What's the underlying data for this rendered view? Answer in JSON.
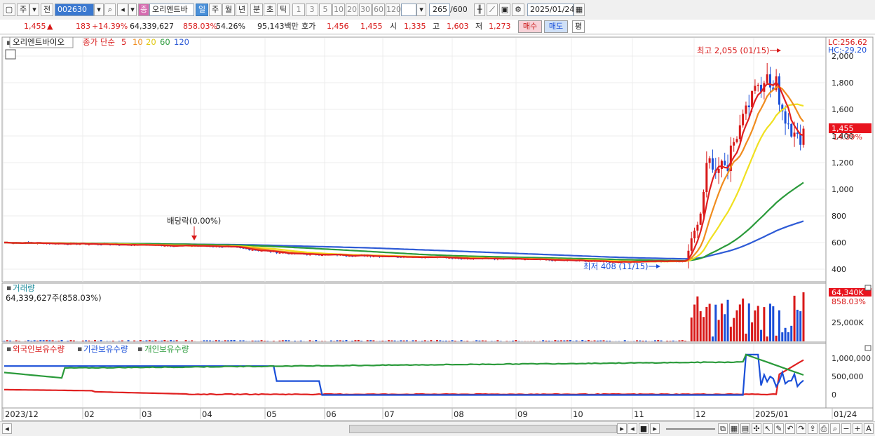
{
  "toolbar": {
    "period_left": "주",
    "jeon_label": "전",
    "code": "002630",
    "stock_name": "오리엔트바",
    "jong_badge": "종",
    "periods": [
      "일",
      "주",
      "월",
      "년",
      "분",
      "초",
      "틱"
    ],
    "intervals": [
      "1",
      "3",
      "5",
      "10",
      "20",
      "30",
      "60",
      "120"
    ],
    "count": "265",
    "count_total": "/600",
    "date": "2025/01/24"
  },
  "info": {
    "price": "1,455",
    "up_arrow": "▲",
    "change": "183",
    "change_pct": "+14.39%",
    "volume": "64,339,627",
    "vol_pct": "858.03%",
    "rate": "54.26%",
    "amount": "95,143백만",
    "hoga_label": "호가",
    "ask": "1,456",
    "bid": "1,455",
    "open_label": "시",
    "open": "1,335",
    "high_label": "고",
    "high": "1,603",
    "low_label": "저",
    "low": "1,273",
    "buy_label": "매수",
    "sell_label": "매도",
    "avg_label": "평"
  },
  "price_panel": {
    "stock_label": "오리엔트바이오",
    "ma_label": "종가 단순",
    "ma_periods": [
      "5",
      "10",
      "20",
      "60",
      "120"
    ],
    "lc": "LC:256.62",
    "hc": "HC:-29.20",
    "high_note": "최고 2,055 (01/15)",
    "low_note": "최저 408 (11/15)",
    "dividend_note": "배당락(0.00%)",
    "current_price": "1,455",
    "current_pct": "14.39%",
    "y_ticks": [
      "2,000",
      "1,800",
      "1,600",
      "1,400",
      "1,200",
      "1,000",
      "800",
      "600",
      "400"
    ]
  },
  "volume_panel": {
    "title": "거래량",
    "value": "64,339,627주(858.03%)",
    "badge": "64,340K",
    "badge_pct": "858.03%",
    "tick": "25,000K"
  },
  "holdings_panel": {
    "legend": [
      "외국인보유수량",
      "기관보유수량",
      "개인보유수량"
    ],
    "y_ticks": [
      "1,000,000",
      "500,000",
      "0"
    ]
  },
  "x_axis": [
    "2023/12",
    "02",
    "03",
    "04",
    "05",
    "06",
    "07",
    "08",
    "09",
    "10",
    "11",
    "12",
    "2025/01",
    "01/24"
  ],
  "colors": {
    "ma5": "#e02020",
    "ma10": "#f08c1e",
    "ma20": "#f0e020",
    "ma60": "#2a9a3a",
    "ma120": "#2e5bd6",
    "up": "#d81818",
    "down": "#1a4fd8"
  }
}
